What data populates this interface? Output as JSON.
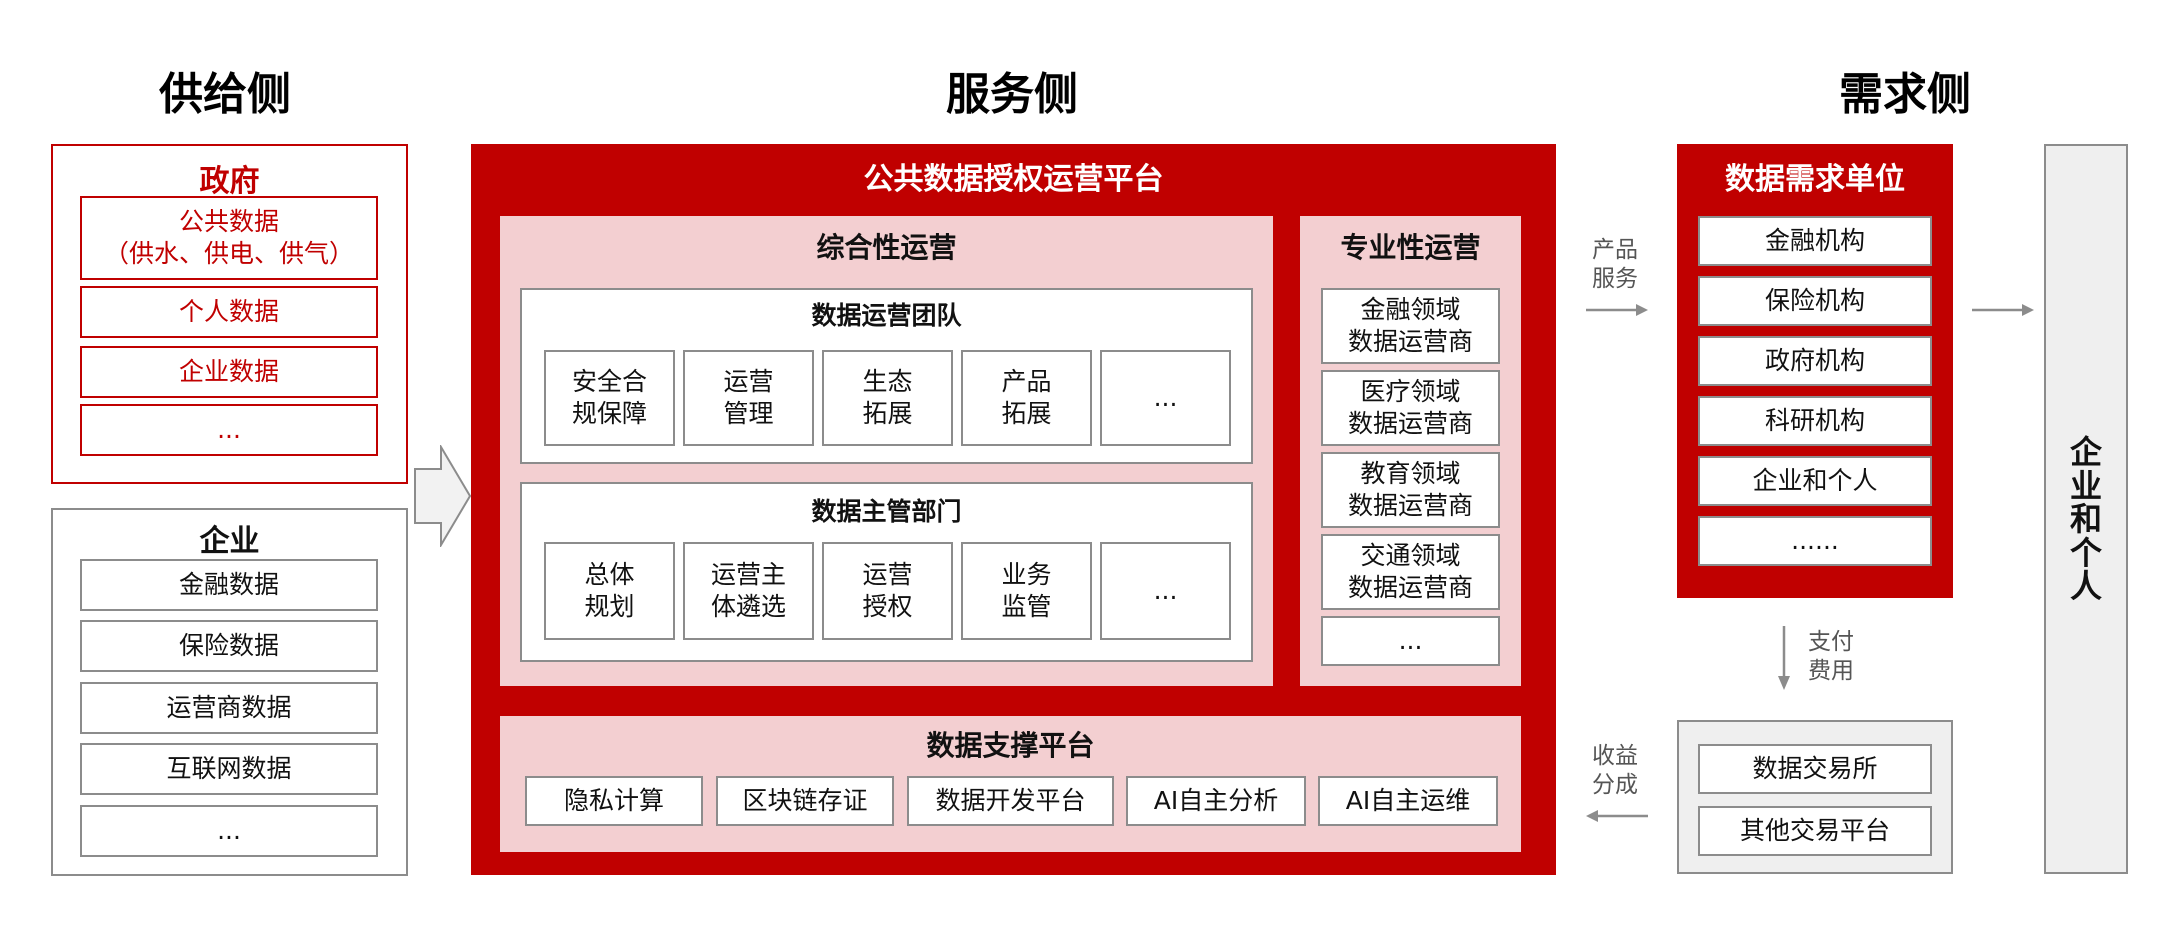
{
  "headers": {
    "supply": "供给侧",
    "service": "服务侧",
    "demand": "需求侧"
  },
  "government": {
    "title": "政府",
    "items": [
      "公共数据\n（供水、供电、供气）",
      "个人数据",
      "企业数据",
      "..."
    ]
  },
  "enterprise": {
    "title": "企业",
    "items": [
      "金融数据",
      "保险数据",
      "运营商数据",
      "互联网数据",
      "..."
    ]
  },
  "platform": {
    "title": "公共数据授权运营平台",
    "comprehensive": {
      "title": "综合性运营",
      "team": {
        "title": "数据运营团队",
        "items": [
          "安全合\n规保障",
          "运营\n管理",
          "生态\n拓展",
          "产品\n拓展",
          "..."
        ]
      },
      "dept": {
        "title": "数据主管部门",
        "items": [
          "总体\n规划",
          "运营主\n体遴选",
          "运营\n授权",
          "业务\n监管",
          "..."
        ]
      }
    },
    "professional": {
      "title": "专业性运营",
      "items": [
        "金融领域\n数据运营商",
        "医疗领域\n数据运营商",
        "教育领域\n数据运营商",
        "交通领域\n数据运营商",
        "..."
      ]
    },
    "support": {
      "title": "数据支撑平台",
      "items": [
        "隐私计算",
        "区块链存证",
        "数据开发平台",
        "AI自主分析",
        "AI自主运维"
      ]
    }
  },
  "flows": {
    "product_service": "产品\n服务",
    "pay_fee": "支付\n费用",
    "revenue_share": "收益\n分成"
  },
  "demand_units": {
    "title": "数据需求单位",
    "items": [
      "金融机构",
      "保险机构",
      "政府机构",
      "科研机构",
      "企业和个人",
      "......"
    ]
  },
  "exchanges": {
    "items": [
      "数据交易所",
      "其他交易平台"
    ]
  },
  "end_user": {
    "label": "企业和个人"
  },
  "colors": {
    "brand_red": "#c00000",
    "pink": "#f3cfd1",
    "border_gray": "#8c8c8c",
    "light_gray": "#efefef"
  }
}
